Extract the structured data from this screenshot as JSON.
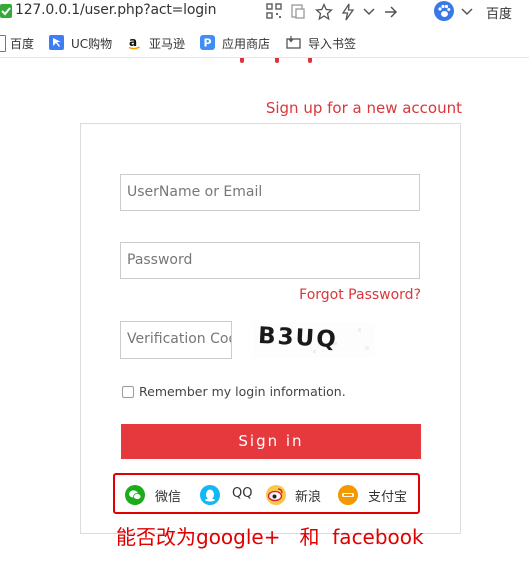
{
  "browser": {
    "url": "127.0.0.1/user.php?act=login",
    "search_engine": "百度"
  },
  "bookmarks": [
    {
      "label": "百度",
      "icon": "baidu-icon"
    },
    {
      "label": "UC购物",
      "icon": "uc-shopping-icon"
    },
    {
      "label": "亚马逊",
      "icon": "amazon-icon"
    },
    {
      "label": "应用商店",
      "icon": "app-store-icon"
    },
    {
      "label": "导入书签",
      "icon": "import-bookmarks-icon"
    }
  ],
  "page": {
    "signup_link": "Sign up for a new account",
    "username_placeholder": "UserName or Email",
    "password_placeholder": "Password",
    "forgot_password": "Forgot Password?",
    "verification_placeholder": "Verification Code",
    "captcha_text": "B3UQ",
    "remember_label": "Remember my login information.",
    "signin_label": "Sign in"
  },
  "social_logins": [
    {
      "label": "微信",
      "icon": "wechat-icon",
      "color": "#1aad19"
    },
    {
      "label": "QQ",
      "icon": "qq-icon",
      "color": "#12b7f5"
    },
    {
      "label": "新浪",
      "icon": "weibo-icon",
      "color": "#e6162d"
    },
    {
      "label": "支付宝",
      "icon": "alipay-icon",
      "color": "#f39800"
    }
  ],
  "annotation": "能否改为google+   和  facebook",
  "colors": {
    "accent": "#e5393d",
    "annotation": "#e00000",
    "link": "#d9373b"
  }
}
